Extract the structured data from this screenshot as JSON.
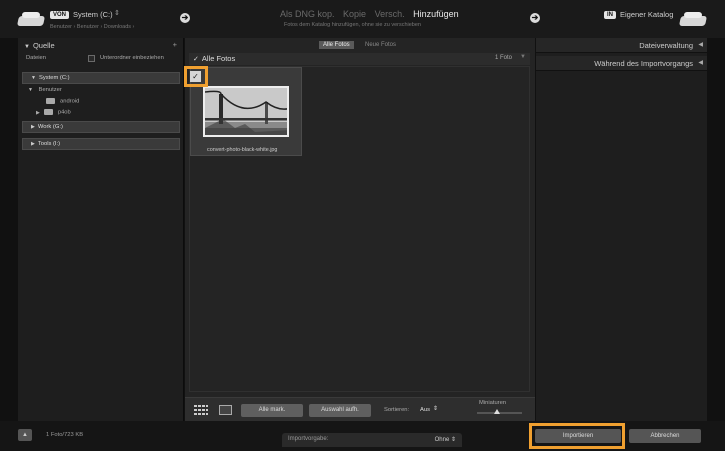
{
  "header": {
    "source_tag": "VON",
    "source_name": "System (C:)",
    "breadcrumb": "Benutzer › Benutzer › Downloads ›",
    "modes": [
      "Als DNG kop.",
      "Kopie",
      "Versch.",
      "Hinzufügen"
    ],
    "active_mode": "Hinzufügen",
    "mode_subtitle": "Fotos dem Katalog hinzufügen, ohne sie zu verschieben",
    "target_tag": "IN",
    "target_name": "Eigener Katalog"
  },
  "left_panel": {
    "title": "Quelle",
    "files_label": "Dateien",
    "subfolders_label": "Unterordner einbeziehen",
    "volumes": [
      "System (C:)",
      "Work (G:)",
      "Tools (I:)"
    ],
    "folder_root": "Benutzer",
    "folders": [
      "android",
      "p4ob"
    ]
  },
  "center": {
    "tabs": [
      "Alle Fotos",
      "Neue Fotos"
    ],
    "grid_title": "Alle Fotos",
    "photo_count": "1 Foto",
    "photo_filename": "convert-photo-black-white.jpg",
    "toolbar": {
      "mark_all": "Alle mark.",
      "unmark_all": "Auswahl aufh.",
      "sort_label": "Sortieren:",
      "sort_value": "Aus",
      "thumb_label": "Miniaturen"
    }
  },
  "right_panel": {
    "sections": [
      "Dateiverwaltung",
      "Während des Importvorgangs"
    ]
  },
  "footer": {
    "status": "1 Foto/723 KB",
    "preset_label": "Importvorgabe:",
    "preset_value": "Ohne",
    "import_button": "Importieren",
    "cancel_button": "Abbrechen"
  },
  "colors": {
    "highlight": "#f0a030",
    "panel": "#1e1e1e",
    "grid": "#242424"
  }
}
